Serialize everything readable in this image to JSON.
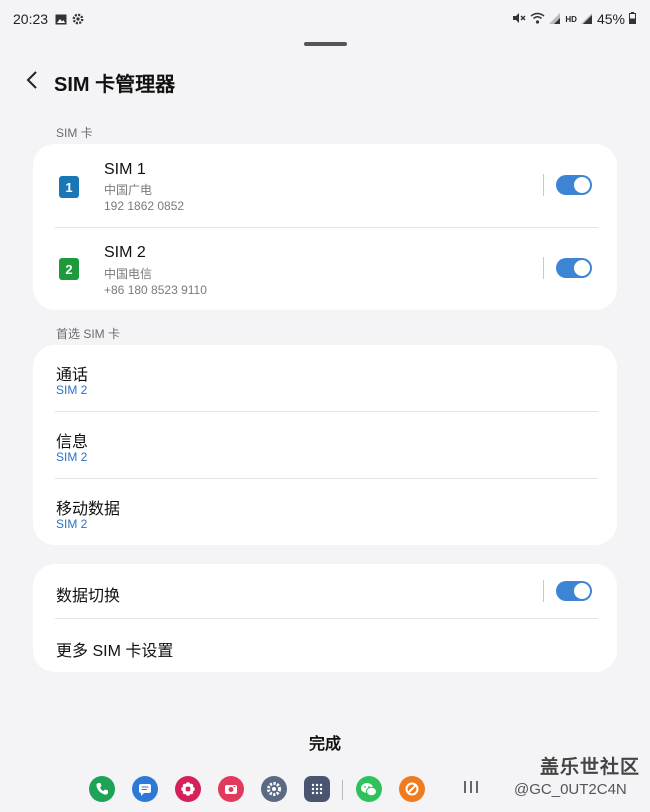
{
  "status_bar": {
    "time": "20:23",
    "battery": "45%"
  },
  "header": {
    "title": "SIM 卡管理器"
  },
  "sim_section": {
    "label": "SIM 卡",
    "sims": [
      {
        "badge": "1",
        "name": "SIM 1",
        "carrier": "中国广电",
        "number": "192 1862 0852",
        "color": "#1977b5",
        "enabled": true
      },
      {
        "badge": "2",
        "name": "SIM 2",
        "carrier": "中国电信",
        "number": "+86 180 8523 9110",
        "color": "#1e9a3c",
        "enabled": true
      }
    ]
  },
  "preferred_section": {
    "label": "首选 SIM 卡",
    "items": [
      {
        "label": "通话",
        "value": "SIM 2"
      },
      {
        "label": "信息",
        "value": "SIM 2"
      },
      {
        "label": "移动数据",
        "value": "SIM 2"
      }
    ]
  },
  "extra": {
    "data_switch_label": "数据切换",
    "data_switch_enabled": true,
    "more_settings_label": "更多 SIM 卡设置"
  },
  "done_label": "完成",
  "watermark": {
    "brand": "盖乐世社区",
    "handle": "@GC_0UT2C4N"
  },
  "accent_color": "#3e84d4",
  "dock_icons": [
    "phone-icon",
    "messages-icon",
    "petal-icon",
    "camera-icon",
    "settings-icon",
    "app-drawer-icon",
    "wechat-icon",
    "browser-icon"
  ]
}
